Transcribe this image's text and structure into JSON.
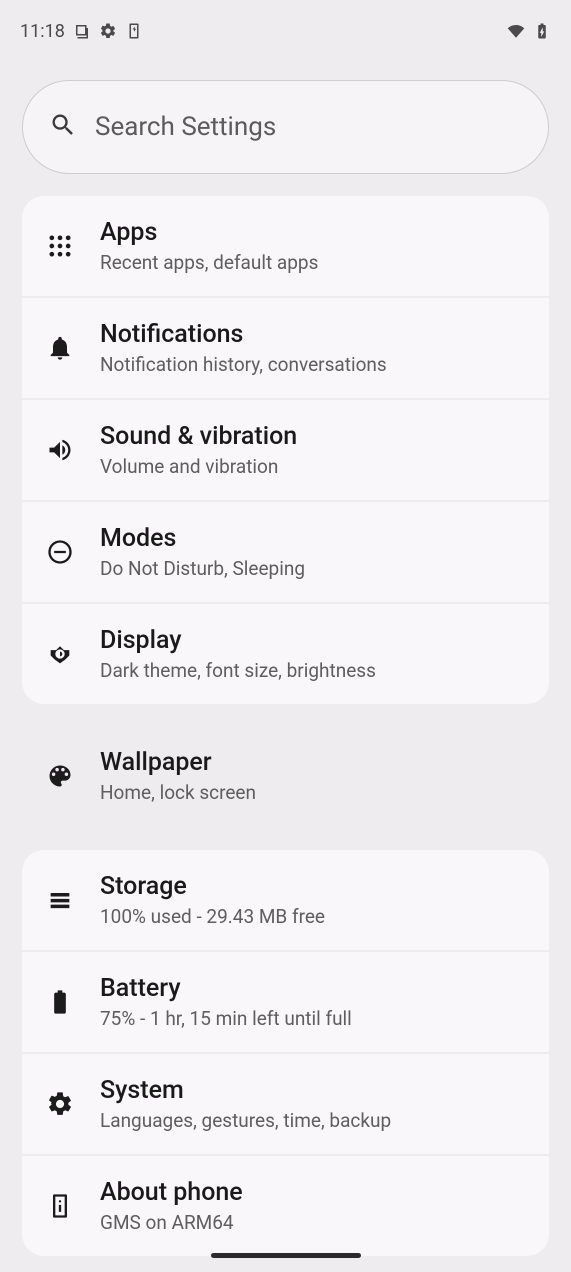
{
  "statusbar": {
    "time": "11:18"
  },
  "search": {
    "placeholder": "Search Settings"
  },
  "items": [
    {
      "title": "Apps",
      "sub": "Recent apps, default apps"
    },
    {
      "title": "Notifications",
      "sub": "Notification history, conversations"
    },
    {
      "title": "Sound & vibration",
      "sub": "Volume and vibration"
    },
    {
      "title": "Modes",
      "sub": "Do Not Disturb, Sleeping"
    },
    {
      "title": "Display",
      "sub": "Dark theme, font size, brightness"
    },
    {
      "title": "Wallpaper",
      "sub": "Home, lock screen"
    },
    {
      "title": "Storage",
      "sub": "100% used - 29.43 MB free"
    },
    {
      "title": "Battery",
      "sub": "75% - 1 hr, 15 min left until full"
    },
    {
      "title": "System",
      "sub": "Languages, gestures, time, backup"
    },
    {
      "title": "About phone",
      "sub": "GMS on ARM64"
    }
  ]
}
